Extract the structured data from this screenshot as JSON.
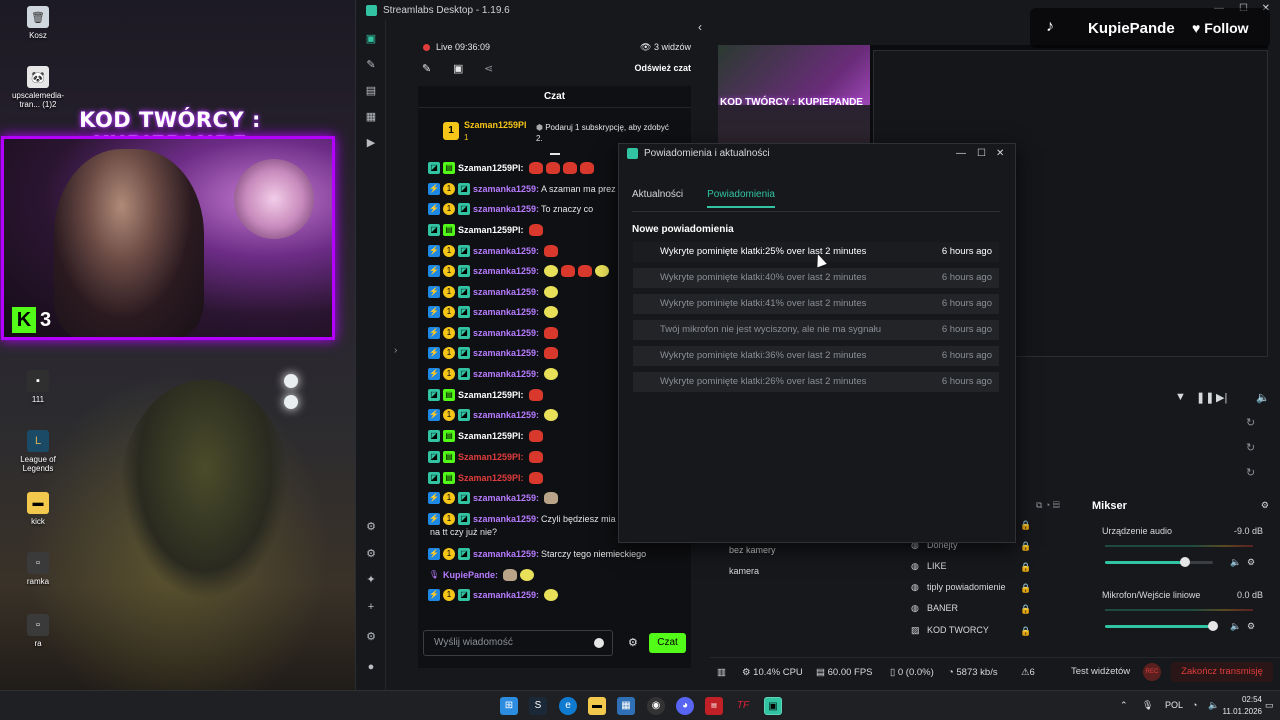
{
  "desktop": {
    "icons": [
      {
        "label": "Kosz",
        "icon": "recycle-bin-icon"
      },
      {
        "label": "upscalemedia-tran... (1)2",
        "icon": "image-file-icon"
      },
      {
        "label": "111",
        "icon": "shortcut-icon"
      },
      {
        "label": "League of Legends",
        "icon": "league-icon"
      },
      {
        "label": "kick",
        "icon": "folder-icon"
      },
      {
        "label": "ramka",
        "icon": "file-icon"
      },
      {
        "label": "ra",
        "icon": "file-icon"
      }
    ],
    "webcam_title": "KOD TWÓRCY : KUPIEPANDE",
    "kick_badge_letter": "K",
    "kick_badge_count": "3"
  },
  "window": {
    "title": "Streamlabs Desktop - 1.19.6",
    "accent": "#31c3a2"
  },
  "chat_top": {
    "live_label": "Live 09:36:09",
    "viewers": "3 widzów",
    "refresh": "Odśwież czat"
  },
  "chat": {
    "header": "Czat",
    "pinned": {
      "rank": "1",
      "user": "Szaman1259Pl",
      "count": "1",
      "text": "Podaruj 1 subskrypcję, aby zdobyć 2."
    },
    "messages": [
      {
        "user": "Szaman1259Pl:",
        "text": "",
        "color": "#ffffff"
      },
      {
        "user": "szamanka1259:",
        "text": "A szaman ma prez",
        "color": "#b77cff"
      },
      {
        "user": "szamanka1259:",
        "text": "To znaczy co",
        "color": "#b77cff"
      },
      {
        "user": "Szaman1259Pl:",
        "text": "",
        "color": "#ffffff"
      },
      {
        "user": "szamanka1259:",
        "text": "",
        "color": "#b77cff"
      },
      {
        "user": "szamanka1259:",
        "text": "",
        "color": "#b77cff"
      },
      {
        "user": "szamanka1259:",
        "text": "",
        "color": "#b77cff"
      },
      {
        "user": "szamanka1259:",
        "text": "",
        "color": "#b77cff"
      },
      {
        "user": "szamanka1259:",
        "text": "",
        "color": "#b77cff"
      },
      {
        "user": "szamanka1259:",
        "text": "",
        "color": "#b77cff"
      },
      {
        "user": "szamanka1259:",
        "text": "",
        "color": "#b77cff"
      },
      {
        "user": "Szaman1259Pl:",
        "text": "",
        "color": "#ffffff"
      },
      {
        "user": "szamanka1259:",
        "text": "",
        "color": "#b77cff"
      },
      {
        "user": "Szaman1259Pl:",
        "text": "",
        "color": "#ffffff"
      },
      {
        "user": "Szaman1259Pl:",
        "text": "",
        "color": "#e03c3c"
      },
      {
        "user": "Szaman1259Pl:",
        "text": "",
        "color": "#e03c3c"
      },
      {
        "user": "szamanka1259:",
        "text": "",
        "color": "#b77cff"
      },
      {
        "user": "szamanka1259:",
        "text": "Czyli będziesz mia",
        "color": "#b77cff"
      },
      {
        "user": "",
        "text": "na tt czy już nie?",
        "color": "#b77cff"
      },
      {
        "user": "szamanka1259:",
        "text": "Starczy tego niemieckiego",
        "color": "#b77cff"
      },
      {
        "user": "KupiePande:",
        "text": "",
        "color": "#b77cff"
      },
      {
        "user": "szamanka1259:",
        "text": "",
        "color": "#b77cff"
      }
    ],
    "input_placeholder": "Wyślij wiadomość",
    "send_label": "Czat"
  },
  "tiktok": {
    "name": "KupiePande",
    "follow": "Follow"
  },
  "preview": {
    "cam_label": "KOD TWÓRCY : KUPIEPANDE"
  },
  "notifications": {
    "title": "Powiadomienia i aktualności",
    "tabs": [
      "Aktualności",
      "Powiadomienia"
    ],
    "active_tab": "Powiadomienia",
    "section": "Nowe powiadomienia",
    "items": [
      {
        "text": "Wykryte pominięte klatki:25% over last 2 minutes",
        "time": "6 hours ago"
      },
      {
        "text": "Wykryte pominięte klatki:40% over last 2 minutes",
        "time": "6 hours ago"
      },
      {
        "text": "Wykryte pominięte klatki:41% over last 2 minutes",
        "time": "6 hours ago"
      },
      {
        "text": "Twój mikrofon nie jest wyciszony, ale nie ma sygnału",
        "time": "6 hours ago"
      },
      {
        "text": "Wykryte pominięte klatki:36% over last 2 minutes",
        "time": "6 hours ago"
      },
      {
        "text": "Wykryte pominięte klatki:26% over last 2 minutes",
        "time": "6 hours ago"
      }
    ]
  },
  "scenes": {
    "items": [
      "bez kamery",
      "kamera"
    ]
  },
  "sources": {
    "items": [
      "Donejty",
      "LIKE",
      "tiply powiadomienie",
      "BANER",
      "KOD TWORCY"
    ]
  },
  "mixer": {
    "title": "Mikser",
    "channels": [
      {
        "label": "Urządzenie audio",
        "db": "-9.0 dB",
        "level": 0.74
      },
      {
        "label": "Mikrofon/Wejście liniowe",
        "db": "0.0 dB",
        "level": 1.0
      }
    ]
  },
  "status": {
    "cpu": "10.4% CPU",
    "fps": "60.00 FPS",
    "dropped": "0 (0.0%)",
    "bitrate": "5873 kb/s",
    "warnings": "6",
    "test_widgets": "Test widżetów",
    "rec": "REC",
    "end_stream": "Zakończ transmisję"
  },
  "taskbar": {
    "lang": "POL",
    "time": "02:54",
    "date": "11.01.2026"
  }
}
